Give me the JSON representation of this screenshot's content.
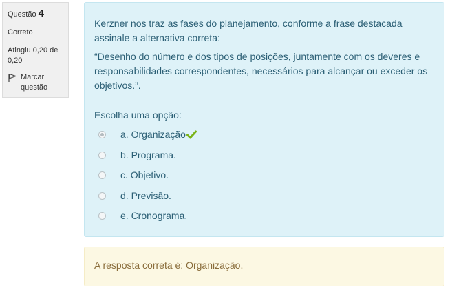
{
  "info": {
    "question_label": "Questão",
    "question_number": "4",
    "state": "Correto",
    "grade": "Atingiu 0,20 de 0,20",
    "flag_label": "Marcar questão"
  },
  "question": {
    "text_intro": "Kerzner nos traz as fases do planejamento, conforme a frase destacada assinale a alternativa correta:",
    "text_quote": "“Desenho do número e dos tipos de posições, juntamente com os deveres e responsabilidades correspondentes, necessários para alcançar ou exceder os objetivos.”.",
    "prompt": "Escolha uma opção:",
    "options": [
      {
        "label": "a. Organização",
        "selected": true,
        "correct": true
      },
      {
        "label": "b. Programa.",
        "selected": false
      },
      {
        "label": "c. Objetivo.",
        "selected": false
      },
      {
        "label": "d. Previsão.",
        "selected": false
      },
      {
        "label": "e. Cronograma.",
        "selected": false
      }
    ]
  },
  "feedback": {
    "right_answer": "A resposta correta é: Organização."
  },
  "colors": {
    "formulation_bg": "#def2f8",
    "feedback_bg": "#fcf8e3",
    "correct_check": "#7ab317"
  }
}
